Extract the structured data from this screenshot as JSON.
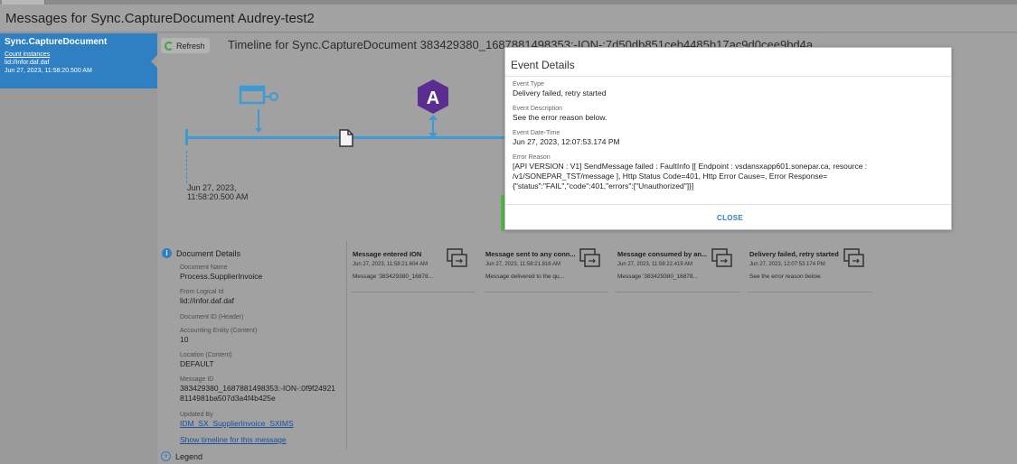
{
  "window": {
    "title": "Messages for Sync.CaptureDocument Audrey-test2"
  },
  "sidebar": {
    "selected": {
      "name": "Sync.CaptureDocument",
      "link": "Count instances",
      "lid": "lid://infor.daf.daf",
      "date": "Jun 27, 2023, 11:58:20.500 AM"
    }
  },
  "toolbar": {
    "refresh_label": "Refresh"
  },
  "timeline": {
    "title": "Timeline for Sync.CaptureDocument 383429380_1687881498353:-ION-:7d50db851ceb4485b17ac9d0cee9bd4a",
    "start_date_line1": "Jun 27, 2023,",
    "start_date_line2": "11:58:20.500 AM",
    "app_badge_letter": "A"
  },
  "document_details": {
    "header": "Document Details",
    "document_name_label": "Document Name",
    "document_name": "Process.SupplierInvoice",
    "from_logical_id_label": "From Logical Id",
    "from_logical_id": "lid://infor.daf.daf",
    "document_id_label": "Document ID (Header)",
    "accounting_entity_label": "Accounting Entity (Content)",
    "accounting_entity": "10",
    "location_label": "Location (Content)",
    "location": "DEFAULT",
    "message_id_label": "Message ID",
    "message_id_line1": "383429380_1687881498353:-ION-:0f9f24921",
    "message_id_line2": "8114981ba507d3a4f4b425e",
    "updated_by_label": "Updated By",
    "updated_by": "IDM_SX_SupplierInvoice_SXIMS",
    "show_timeline_link": "Show timeline for this message"
  },
  "events": [
    {
      "title": "Message entered ION",
      "time": "Jun 27, 2023, 11:58:21.604 AM",
      "msg": "Message '383429380_16878..."
    },
    {
      "title": "Message sent to any conn...",
      "time": "Jun 27, 2023, 11:58:21.816 AM",
      "msg": "Message delivered to the qu..."
    },
    {
      "title": "Message consumed by an...",
      "time": "Jun 27, 2023, 11:58:22.419 AM",
      "msg": "Message '383429380_16878..."
    },
    {
      "title": "Delivery failed, retry started",
      "time": "Jun 27, 2023, 12:07:53.174 PM",
      "msg": "See the error reason below."
    }
  ],
  "legend": {
    "label": "Legend"
  },
  "modal": {
    "title": "Event Details",
    "event_type_label": "Event Type",
    "event_type": "Delivery failed, retry started",
    "event_description_label": "Event Description",
    "event_description": "See the error reason below.",
    "event_datetime_label": "Event Date-Time",
    "event_datetime": "Jun 27, 2023, 12:07:53.174 PM",
    "error_reason_label": "Error Reason",
    "error_reason": "[API VERSION : V1] SendMessage failed : FaultInfo [[ Endpoint : vsdansxapp601.sonepar.ca, resource : /v1/SONEPAR_TST/message ], Http Status Code=401, Http Error Cause=, Error Response= {\"status\":\"FAIL\",\"code\":401,\"errors\":[\"Unauthorized\"]}]",
    "close_label": "CLOSE"
  },
  "colors": {
    "accent": "#2f80c2",
    "timeline": "#3c9ad6",
    "badge": "#5b2d91",
    "success": "#58b84a"
  }
}
